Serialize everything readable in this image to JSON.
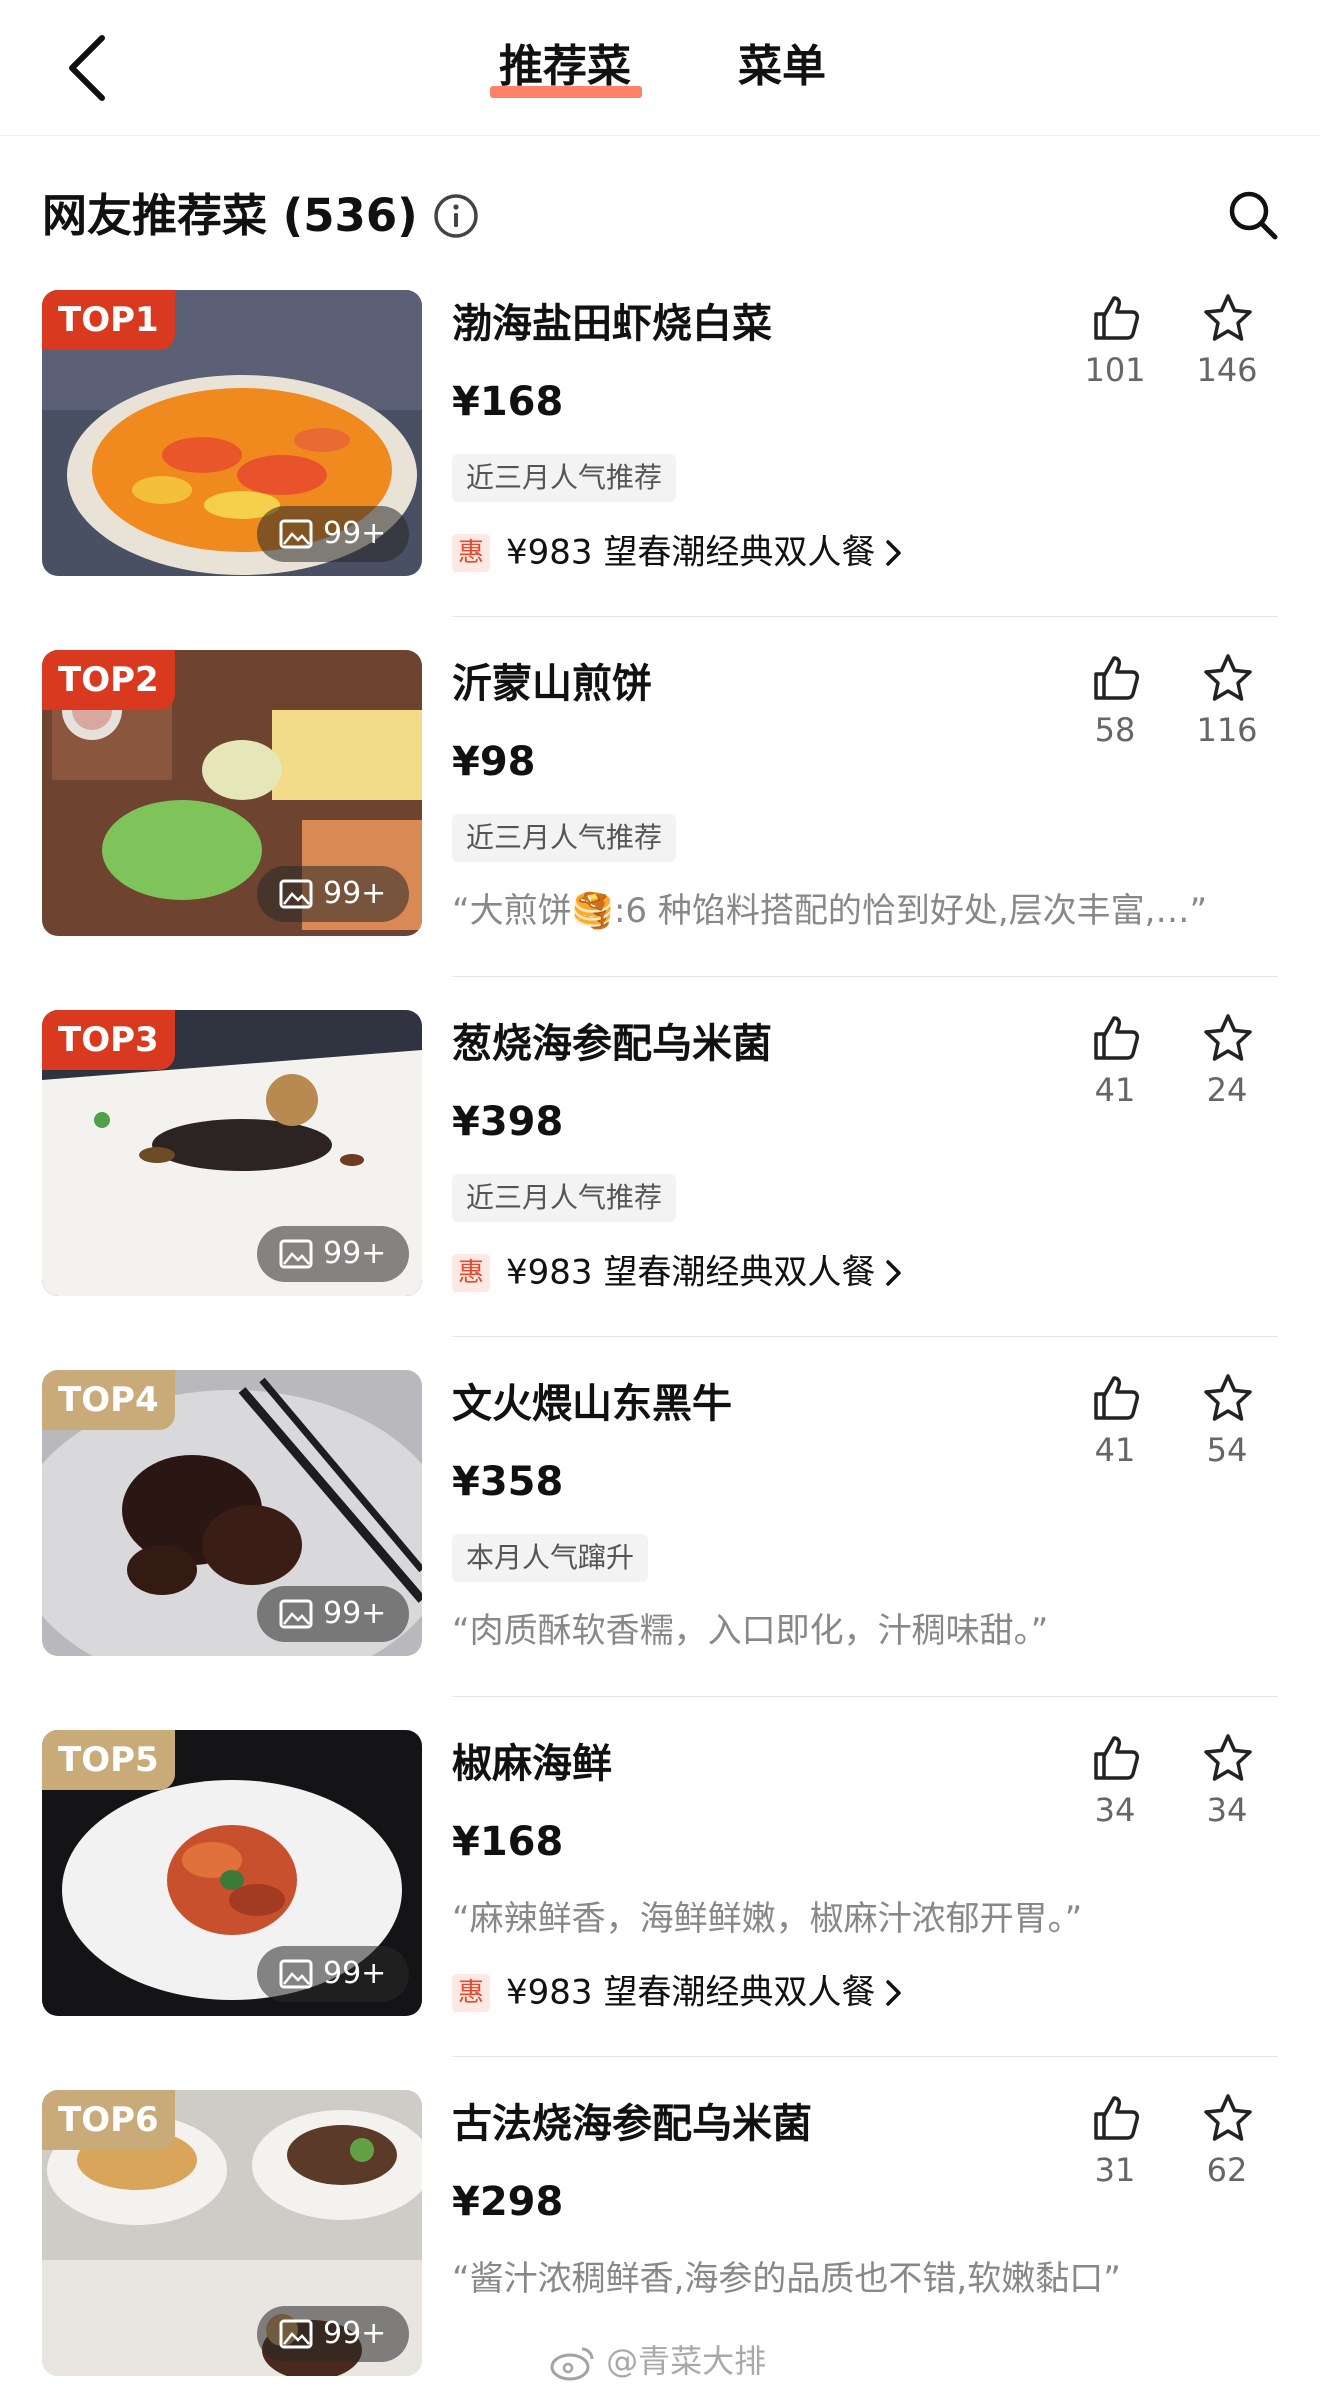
{
  "nav": {
    "tab_active": "推荐菜",
    "tab_other": "菜单"
  },
  "section": {
    "title": "网友推荐菜 (536)"
  },
  "colors": {
    "accent": "#ff6b4d",
    "rank_top3": "#d9391f",
    "rank_other": "#c9ab79",
    "deal": "#e8472b"
  },
  "dishes": [
    {
      "rank": "TOP1",
      "name": "渤海盐田虾烧白菜",
      "price": "¥168",
      "tag": "近三月人气推荐",
      "line3_type": "deal",
      "deal_badge": "惠",
      "line3": "¥983 望春潮经典双人餐",
      "likes": "101",
      "favorites": "146",
      "photo_count": "99+"
    },
    {
      "rank": "TOP2",
      "name": "沂蒙山煎饼",
      "price": "¥98",
      "tag": "近三月人气推荐",
      "line3_type": "quote",
      "line3": "“大煎饼🥞:6 种馅料搭配的恰到好处,层次丰富,…”",
      "likes": "58",
      "favorites": "116",
      "photo_count": "99+"
    },
    {
      "rank": "TOP3",
      "name": "葱烧海参配乌米菌",
      "price": "¥398",
      "tag": "近三月人气推荐",
      "line3_type": "deal",
      "deal_badge": "惠",
      "line3": "¥983 望春潮经典双人餐",
      "likes": "41",
      "favorites": "24",
      "photo_count": "99+"
    },
    {
      "rank": "TOP4",
      "name": "文火煨山东黑牛",
      "price": "¥358",
      "tag": "本月人气蹿升",
      "line3_type": "quote",
      "line3": "“肉质酥软香糯，入口即化，汁稠味甜。”",
      "likes": "41",
      "favorites": "54",
      "photo_count": "99+"
    },
    {
      "rank": "TOP5",
      "name": "椒麻海鲜",
      "price": "¥168",
      "quote": "“麻辣鲜香，海鲜鲜嫩，椒麻汁浓郁开胃。”",
      "line3_type": "deal",
      "deal_badge": "惠",
      "line3": "¥983 望春潮经典双人餐",
      "likes": "34",
      "favorites": "34",
      "photo_count": "99+"
    },
    {
      "rank": "TOP6",
      "name": "古法烧海参配乌米菌",
      "price": "¥298",
      "line3_type": "quote",
      "line3": "“酱汁浓稠鲜香,海参的品质也不错,软嫩黏口”",
      "likes": "31",
      "favorites": "62",
      "photo_count": "99+"
    }
  ],
  "watermark": "@青菜大排"
}
